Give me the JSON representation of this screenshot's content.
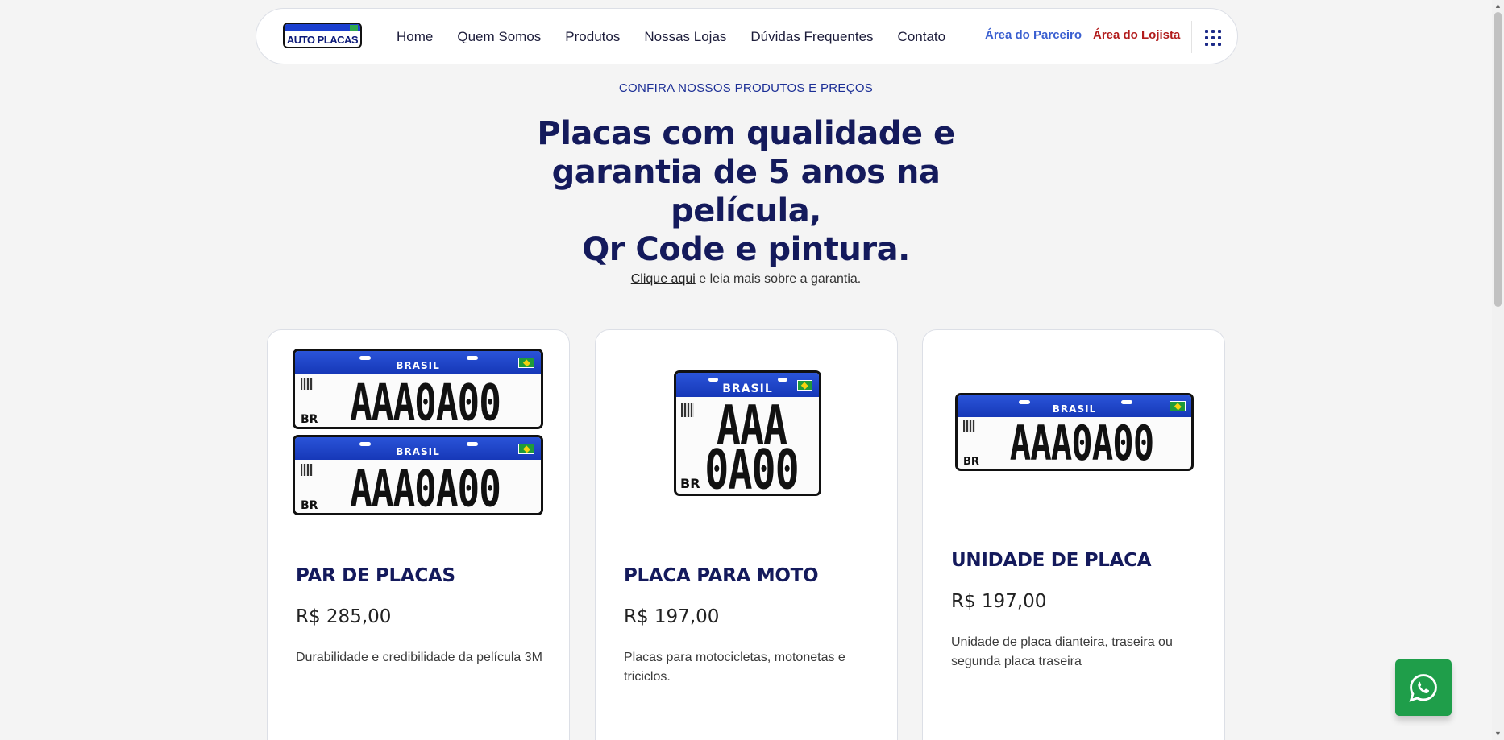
{
  "logo": {
    "text": "AUTO PLACAS"
  },
  "nav": {
    "items": [
      {
        "label": "Home"
      },
      {
        "label": "Quem Somos"
      },
      {
        "label": "Produtos"
      },
      {
        "label": "Nossas Lojas"
      },
      {
        "label": "Dúvidas Frequentes"
      },
      {
        "label": "Contato"
      }
    ],
    "parceiro": "Área do Parceiro",
    "lojista": "Área do Lojista"
  },
  "hero": {
    "eyebrow": "CONFIRA NOSSOS PRODUTOS E PREÇOS",
    "title_line1": "Placas com qualidade e",
    "title_line2": "garantia de 5 anos na película,",
    "title_line3": "Qr Code e pintura.",
    "link_text": "Clique aqui",
    "sub_text": " e leia mais sobre a garantia."
  },
  "plate": {
    "country": "BRASIL",
    "code": "AAA0A00",
    "code_line1": "AAA",
    "code_line2": "0A00",
    "br": "BR"
  },
  "products": [
    {
      "title": "PAR DE PLACAS",
      "price": "R$ 285,00",
      "description": "Durabilidade e credibilidade da película 3M"
    },
    {
      "title": "PLACA PARA MOTO",
      "price": "R$ 197,00",
      "description": "Placas para motocicletas, motonetas e triciclos."
    },
    {
      "title": "UNIDADE DE PLACA",
      "price": "R$ 197,00",
      "description": "Unidade de placa dianteira, traseira ou segunda placa traseira"
    }
  ],
  "colors": {
    "brand_navy": "#141a5c",
    "brand_blue": "#1c2f96",
    "whatsapp": "#1f9e4a",
    "lojista_red": "#b21c1c"
  },
  "icons": {
    "menu": "grid-icon",
    "whatsapp": "whatsapp-icon"
  }
}
